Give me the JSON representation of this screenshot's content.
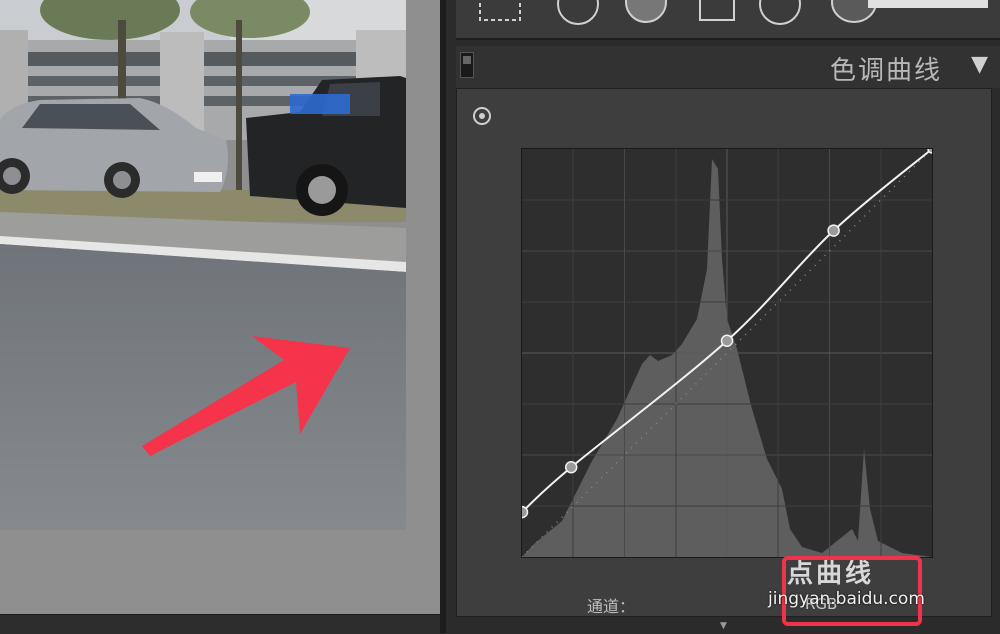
{
  "panel": {
    "title": "色调曲线",
    "collapse_icon": "▼",
    "point_curve_label": "点曲线",
    "channel_label": "通道：",
    "channel_value": "RGB"
  },
  "toolbar": {
    "tools": [
      "crop-overlay-icon",
      "spot-removal-icon",
      "red-eye-icon",
      "graduated-filter-icon",
      "radial-filter-icon",
      "adjustment-brush-icon"
    ]
  },
  "watermark": "jingyan.baidu.com",
  "annotation": {
    "arrow_color": "#f5334a",
    "highlight_color": "#f0334a"
  },
  "curve": {
    "points": [
      [
        0,
        11
      ],
      [
        12,
        22
      ],
      [
        50,
        53
      ],
      [
        76,
        80
      ],
      [
        100,
        100
      ]
    ]
  }
}
